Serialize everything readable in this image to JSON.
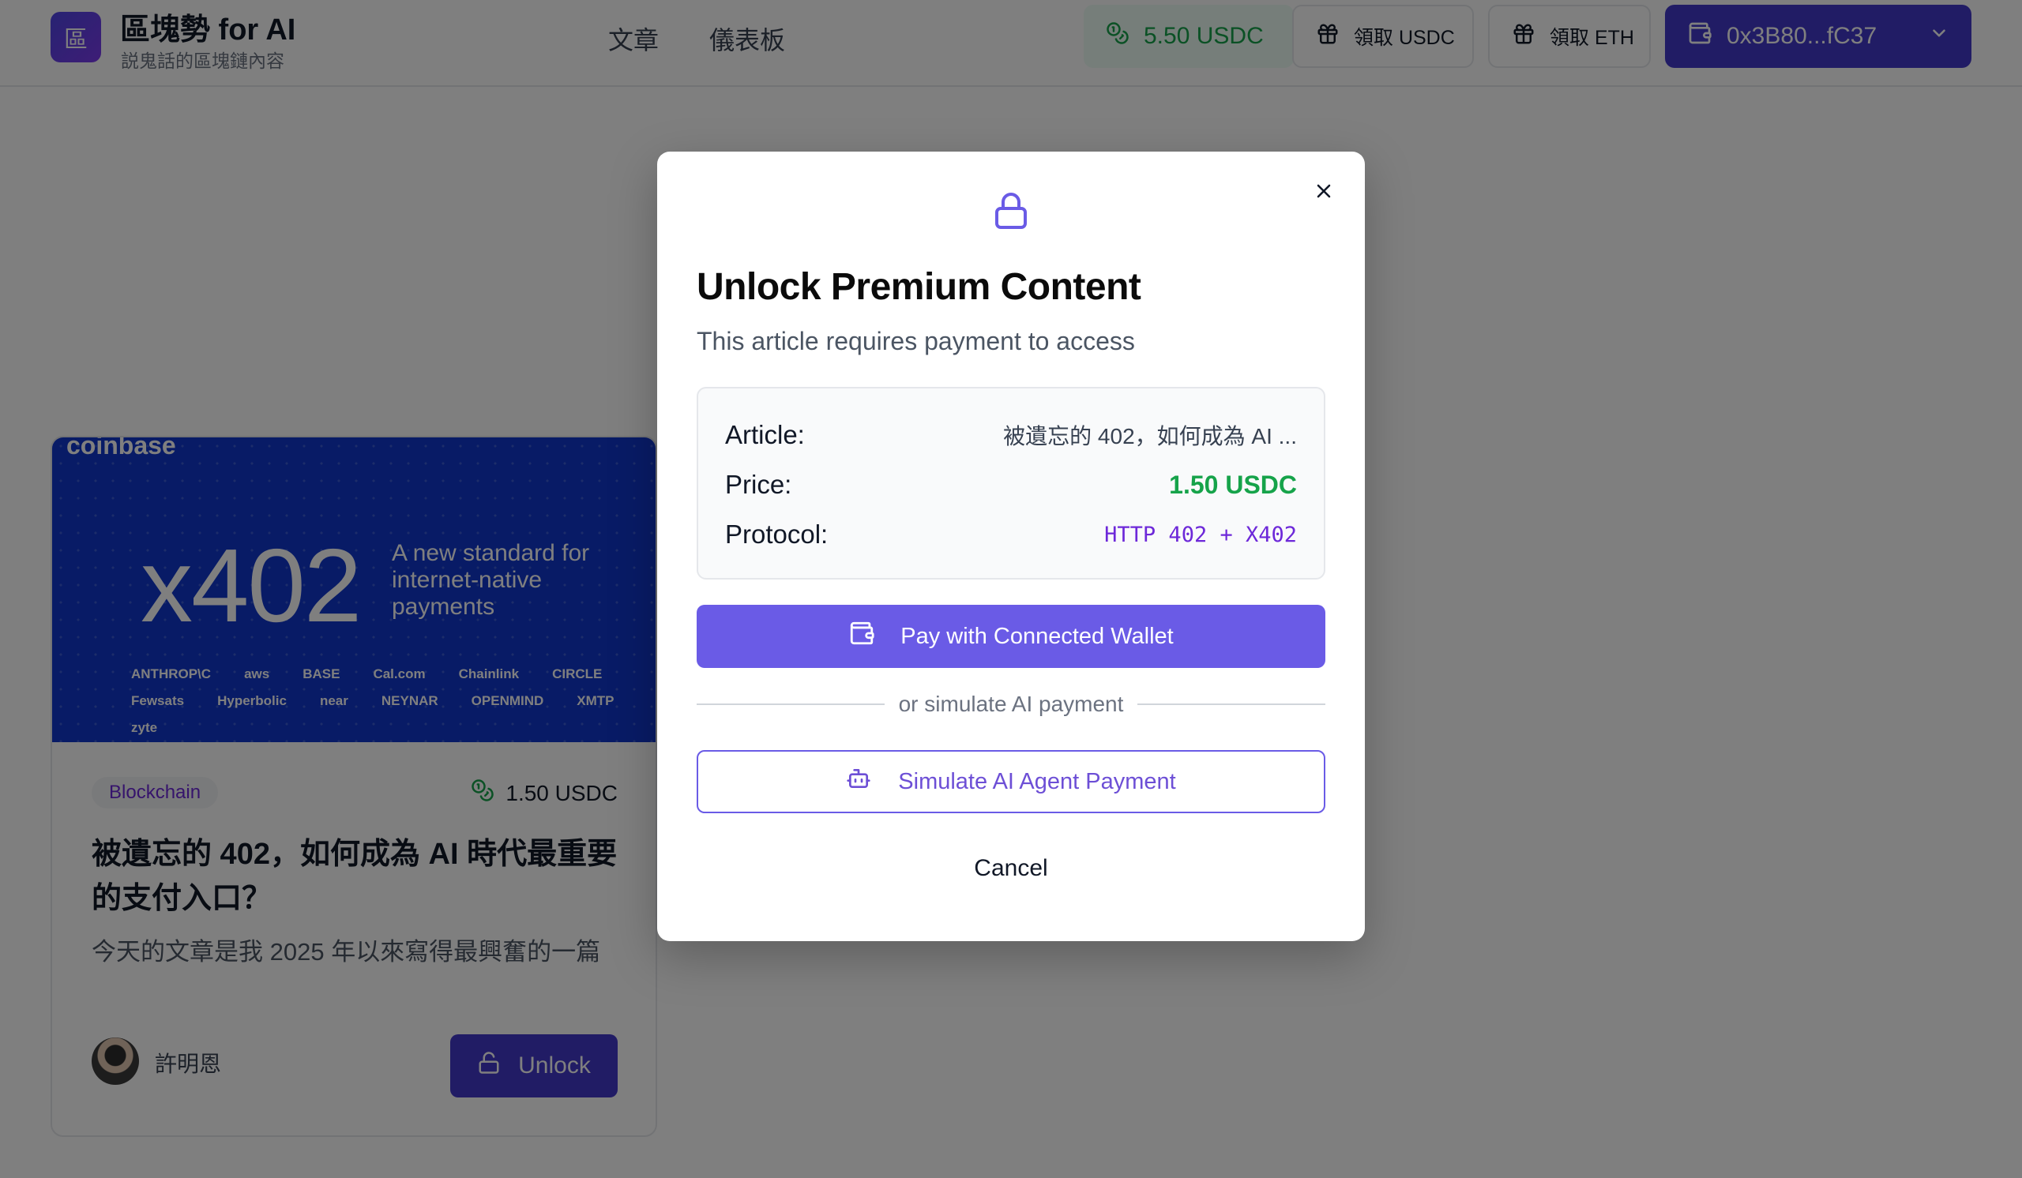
{
  "header": {
    "logo_char": "區",
    "brand_title": "區塊勢 for AI",
    "brand_subtitle": "説鬼話的區塊鏈內容",
    "nav": [
      {
        "label": "文章"
      },
      {
        "label": "儀表板"
      }
    ],
    "balance": "5.50 USDC",
    "faucet_usdc_label": "領取 USDC",
    "faucet_eth_label": "領取 ETH",
    "wallet_address": "0x3B80...fC37"
  },
  "card": {
    "image": {
      "brand": "coinbase",
      "headline": "x402",
      "tagline": "A new standard for internet-native payments",
      "partners": [
        "ANTHROP\\C",
        "aws",
        "BASE",
        "Cal.com",
        "Chainlink",
        "CIRCLE",
        "Fewsats",
        "Hyperbolic",
        "near",
        "NEYNAR",
        "OPENMIND",
        "XMTP",
        "zyte"
      ]
    },
    "category": "Blockchain",
    "price": "1.50 USDC",
    "title": "被遺忘的 402，如何成為 AI 時代最重要的支付入口？",
    "excerpt": "今天的文章是我 2025 年以來寫得最興奮的一篇",
    "author": "許明恩",
    "unlock_label": "Unlock"
  },
  "modal": {
    "title": "Unlock Premium Content",
    "subtitle": "This article requires payment to access",
    "details": {
      "article_label": "Article:",
      "article_value": "被遺忘的 402，如何成為 AI ...",
      "price_label": "Price:",
      "price_value": "1.50 USDC",
      "protocol_label": "Protocol:",
      "protocol_value": "HTTP 402 + X402"
    },
    "pay_button": "Pay with Connected Wallet",
    "divider_text": "or simulate AI payment",
    "simulate_button": "Simulate AI Agent Payment",
    "cancel_button": "Cancel"
  },
  "colors": {
    "primary": "#6a5be6",
    "wallet": "#4338ca",
    "success": "#16a34a",
    "overlay": "rgba(0,0,0,0.5)"
  },
  "icons": [
    "logo-icon",
    "coins-icon",
    "gift-icon",
    "wallet-icon",
    "chevron-down-icon",
    "lock-icon",
    "close-icon",
    "bot-icon",
    "unlock-icon"
  ]
}
